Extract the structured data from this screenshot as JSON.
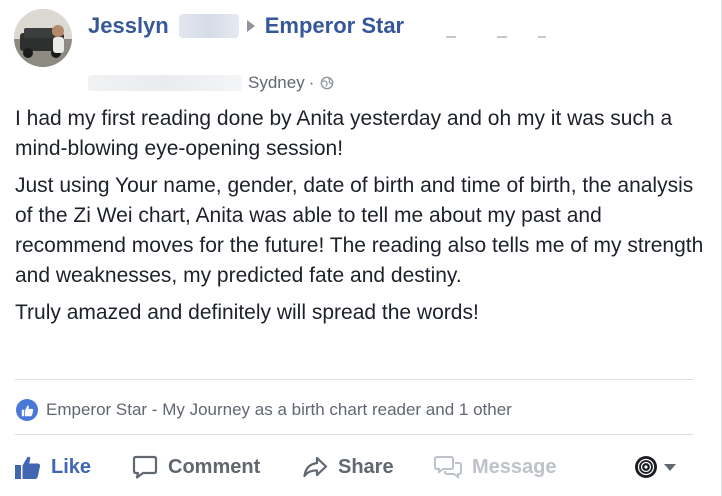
{
  "post": {
    "author": {
      "first_name": "Jesslyn"
    },
    "target_page": "Emperor Star",
    "location": "Sydney",
    "separator": "·",
    "body": [
      "I had my first reading done by Anita yesterday and oh my it was such a mind-blowing eye-opening session!",
      "Just using Your name, gender, date of birth and time of birth, the analysis of the Zi Wei chart, Anita was able to tell me about my past and recommend moves for the future! The reading also tells me of my strength and weaknesses, my predicted fate and destiny.",
      "Truly amazed and definitely will spread the words!"
    ]
  },
  "reactions": {
    "summary": "Emperor Star - My Journey as a birth chart reader and 1 other"
  },
  "actions": {
    "like_label": "Like",
    "comment_label": "Comment",
    "share_label": "Share",
    "message_label": "Message"
  },
  "icons": {
    "avatar": "profile-photo",
    "privacy": "globe-icon",
    "reaction": "like-icon",
    "like": "thumbs-up-icon",
    "comment": "speech-bubble-icon",
    "share": "share-arrow-icon",
    "message": "messenger-bubbles-icon",
    "audience": "page-avatar-icon"
  },
  "colors": {
    "link_blue": "#365899",
    "like_blue": "#4267b2",
    "text": "#1d2129",
    "meta_gray": "#616770",
    "disabled": "#bec3c9"
  }
}
